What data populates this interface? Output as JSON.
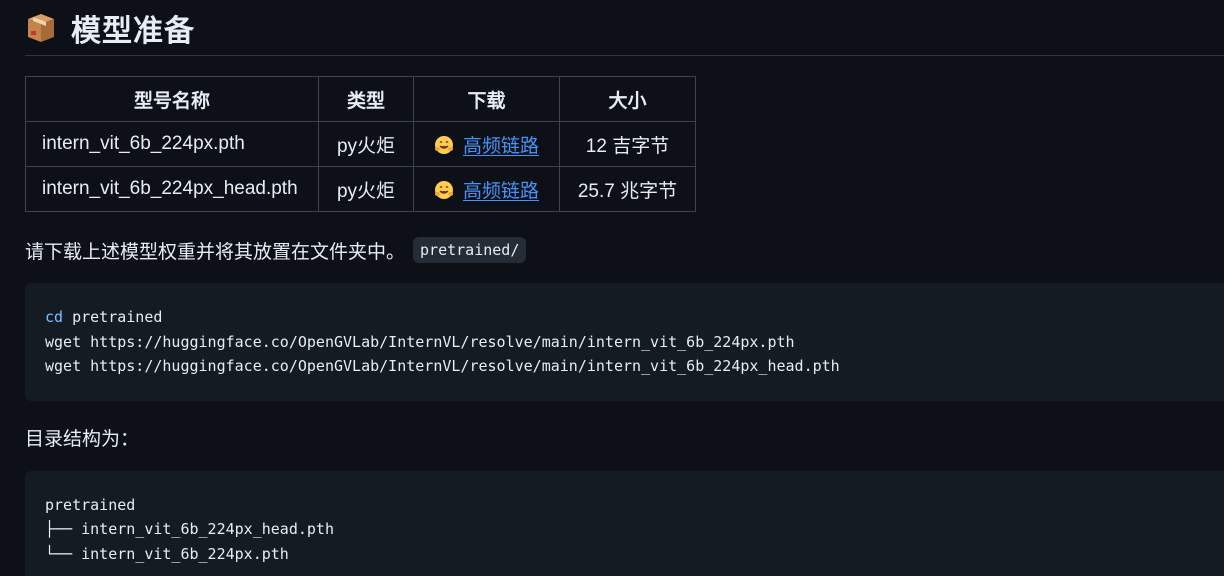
{
  "heading": {
    "icon": "package-box-icon",
    "title": "模型准备"
  },
  "table": {
    "headers": [
      "型号名称",
      "类型",
      "下载",
      "大小"
    ],
    "rows": [
      {
        "name": "intern_vit_6b_224px.pth",
        "type": "py火炬",
        "download_icon": "hugging-face-icon",
        "download_label": "高频链路",
        "size": "12 吉字节"
      },
      {
        "name": "intern_vit_6b_224px_head.pth",
        "type": "py火炬",
        "download_icon": "hugging-face-icon",
        "download_label": "高频链路",
        "size": "25.7 兆字节"
      }
    ]
  },
  "instruction": {
    "text": "请下载上述模型权重并将其放置在文件夹中。",
    "code": "pretrained/"
  },
  "code_block_1": {
    "line1_keyword": "cd",
    "line1_rest": " pretrained",
    "line2": "wget https://huggingface.co/OpenGVLab/InternVL/resolve/main/intern_vit_6b_224px.pth",
    "line3": "wget https://huggingface.co/OpenGVLab/InternVL/resolve/main/intern_vit_6b_224px_head.pth"
  },
  "structure_label": "目录结构为：",
  "code_block_2": {
    "line1": "pretrained",
    "line2": "├── intern_vit_6b_224px_head.pth",
    "line3": "└── intern_vit_6b_224px.pth"
  },
  "colors": {
    "background": "#0d1117",
    "link": "#4493f8",
    "code_background": "#151b23",
    "keyword": "#79c0ff"
  }
}
